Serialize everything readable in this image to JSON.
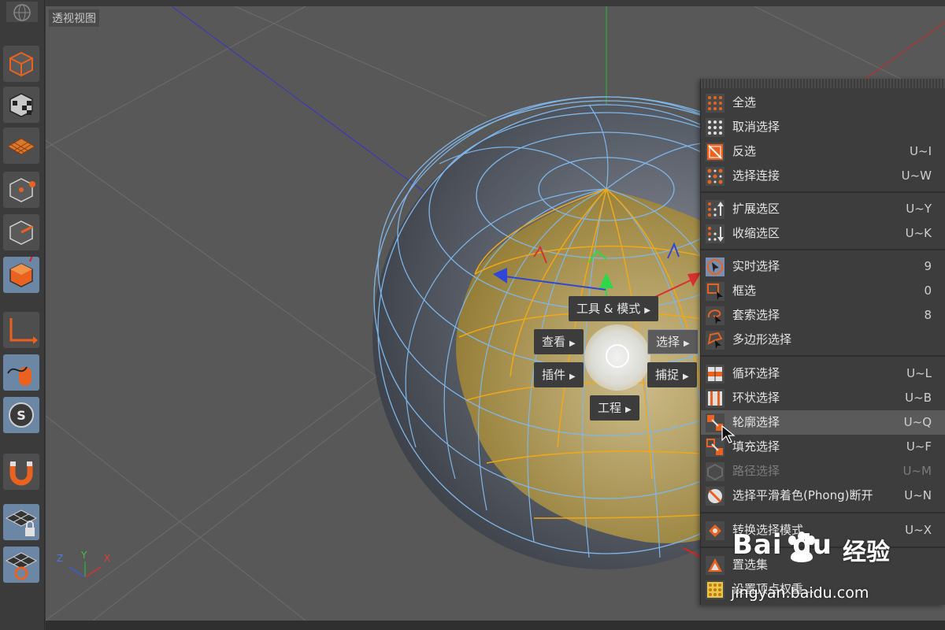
{
  "viewport": {
    "title": "透视视图",
    "axes": {
      "z": "Z",
      "y": "Y",
      "x": "X"
    }
  },
  "toolbar": {
    "items": [
      {
        "icon": "cube-object-mode-icon",
        "active": false
      },
      {
        "icon": "checker-cube-texture-icon",
        "active": false
      },
      {
        "icon": "grid-workplane-icon",
        "active": false
      },
      {
        "icon": "points-mode-icon",
        "active": false
      },
      {
        "icon": "edges-mode-icon",
        "active": false
      },
      {
        "icon": "polygons-mode-icon",
        "active": true
      },
      {
        "icon": "axis-icon",
        "active": false
      },
      {
        "icon": "tweak-mouse-icon",
        "active": false
      },
      {
        "icon": "solo-icon",
        "active": false
      },
      {
        "icon": "snap-magnet-icon",
        "active": false
      },
      {
        "icon": "locked-workplane-icon",
        "active": false
      },
      {
        "icon": "planar-workplane-icon",
        "active": false
      }
    ]
  },
  "radial_menu": {
    "tools_modes": "工具 & 模式",
    "view": "查看",
    "select": "选择",
    "plugins": "插件",
    "snap": "捕捉",
    "project": "工程"
  },
  "context_menu": {
    "items": [
      {
        "label": "全选",
        "shortcut": "",
        "icon": "select-all-icon"
      },
      {
        "label": "取消选择",
        "shortcut": "",
        "icon": "deselect-all-icon"
      },
      {
        "label": "反选",
        "shortcut": "U~I",
        "icon": "invert-selection-icon"
      },
      {
        "label": "选择连接",
        "shortcut": "U~W",
        "icon": "select-connected-icon"
      },
      {
        "label": "扩展选区",
        "shortcut": "U~Y",
        "icon": "grow-selection-icon"
      },
      {
        "label": "收缩选区",
        "shortcut": "U~K",
        "icon": "shrink-selection-icon"
      },
      {
        "label": "实时选择",
        "shortcut": "9",
        "icon": "live-selection-icon"
      },
      {
        "label": "框选",
        "shortcut": "0",
        "icon": "rectangle-selection-icon"
      },
      {
        "label": "套索选择",
        "shortcut": "8",
        "icon": "lasso-selection-icon"
      },
      {
        "label": "多边形选择",
        "shortcut": "",
        "icon": "polygon-selection-icon"
      },
      {
        "label": "循环选择",
        "shortcut": "U~L",
        "icon": "loop-selection-icon"
      },
      {
        "label": "环状选择",
        "shortcut": "U~B",
        "icon": "ring-selection-icon"
      },
      {
        "label": "轮廓选择",
        "shortcut": "U~Q",
        "icon": "outline-selection-icon"
      },
      {
        "label": "填充选择",
        "shortcut": "U~F",
        "icon": "fill-selection-icon"
      },
      {
        "label": "路径选择",
        "shortcut": "U~M",
        "icon": "path-selection-icon"
      },
      {
        "label": "选择平滑着色(Phong)断开",
        "shortcut": "U~N",
        "icon": "phong-break-selection-icon"
      },
      {
        "label": "转换选择模式",
        "shortcut": "U~X",
        "icon": "convert-selection-icon"
      },
      {
        "label": "置选集",
        "shortcut": "",
        "icon": "set-selection-icon"
      },
      {
        "label": "设置顶点权重...",
        "shortcut": "",
        "icon": "vertex-weight-icon"
      }
    ]
  },
  "watermark": {
    "logo": "Bai du",
    "brand": "经验",
    "url": "jingyan.baidu.com"
  },
  "colors": {
    "menu_bg": "#3d3d3d",
    "menu_highlight": "#5a5a5a",
    "accent_orange": "#e9621f",
    "selection_yellow": "#e8a21a",
    "wire_blue": "#6aa9e6",
    "toolbar_active": "#6c86a6"
  }
}
